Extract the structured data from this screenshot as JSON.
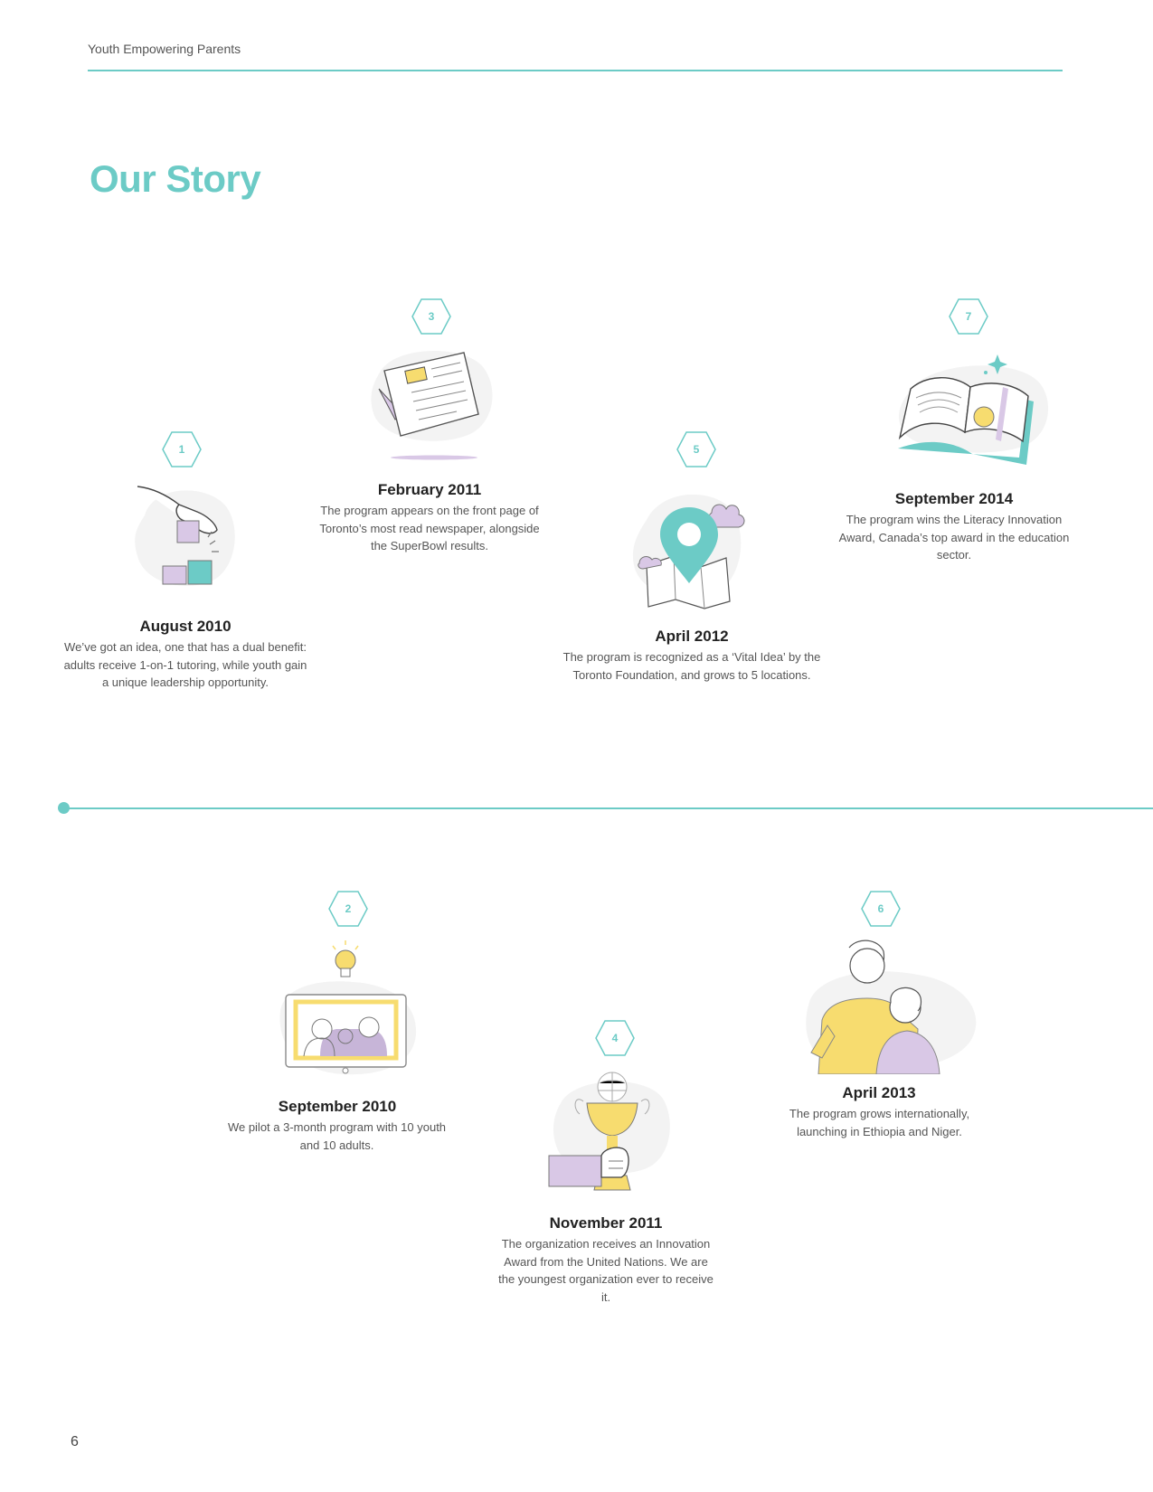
{
  "header": {
    "title": "Youth Empowering Parents"
  },
  "page_title": "Our Story",
  "events": [
    {
      "step": "1",
      "date": "August 2010",
      "desc": "We’ve got an idea, one that has a dual benefit: adults receive 1-on-1 tutoring, while youth gain a unique leadership opportunity.",
      "icon": "hand-blocks-icon"
    },
    {
      "step": "2",
      "date": "September 2010",
      "desc": "We pilot a 3-month program with 10 youth and 10 adults.",
      "icon": "computer-lightbulb-icon"
    },
    {
      "step": "3",
      "date": "February 2011",
      "desc": "The program appears on the front page of Toronto’s most read newspaper, alongside the SuperBowl results.",
      "icon": "newspaper-icon"
    },
    {
      "step": "4",
      "date": "November 2011",
      "desc": "The organization receives an Innovation Award from the United Nations. We are the youngest organization ever to receive it.",
      "icon": "trophy-icon"
    },
    {
      "step": "5",
      "date": "April 2012",
      "desc": "The program is recognized as a ‘Vital Idea’ by the Toronto Foundation, and grows to 5 locations.",
      "icon": "map-pin-icon"
    },
    {
      "step": "6",
      "date": "April 2013",
      "desc": "The program grows internationally, launching in Ethiopia and Niger.",
      "icon": "people-icon"
    },
    {
      "step": "7",
      "date": "September 2014",
      "desc": "The program wins the Literacy Innovation Award, Canada’s top award in the education sector.",
      "icon": "book-medal-icon"
    }
  ],
  "colors": {
    "accent": "#6ccbc6",
    "lavender": "#d9c8e6",
    "yellow": "#f7dc6f"
  },
  "footer": {
    "page_number": "6"
  }
}
